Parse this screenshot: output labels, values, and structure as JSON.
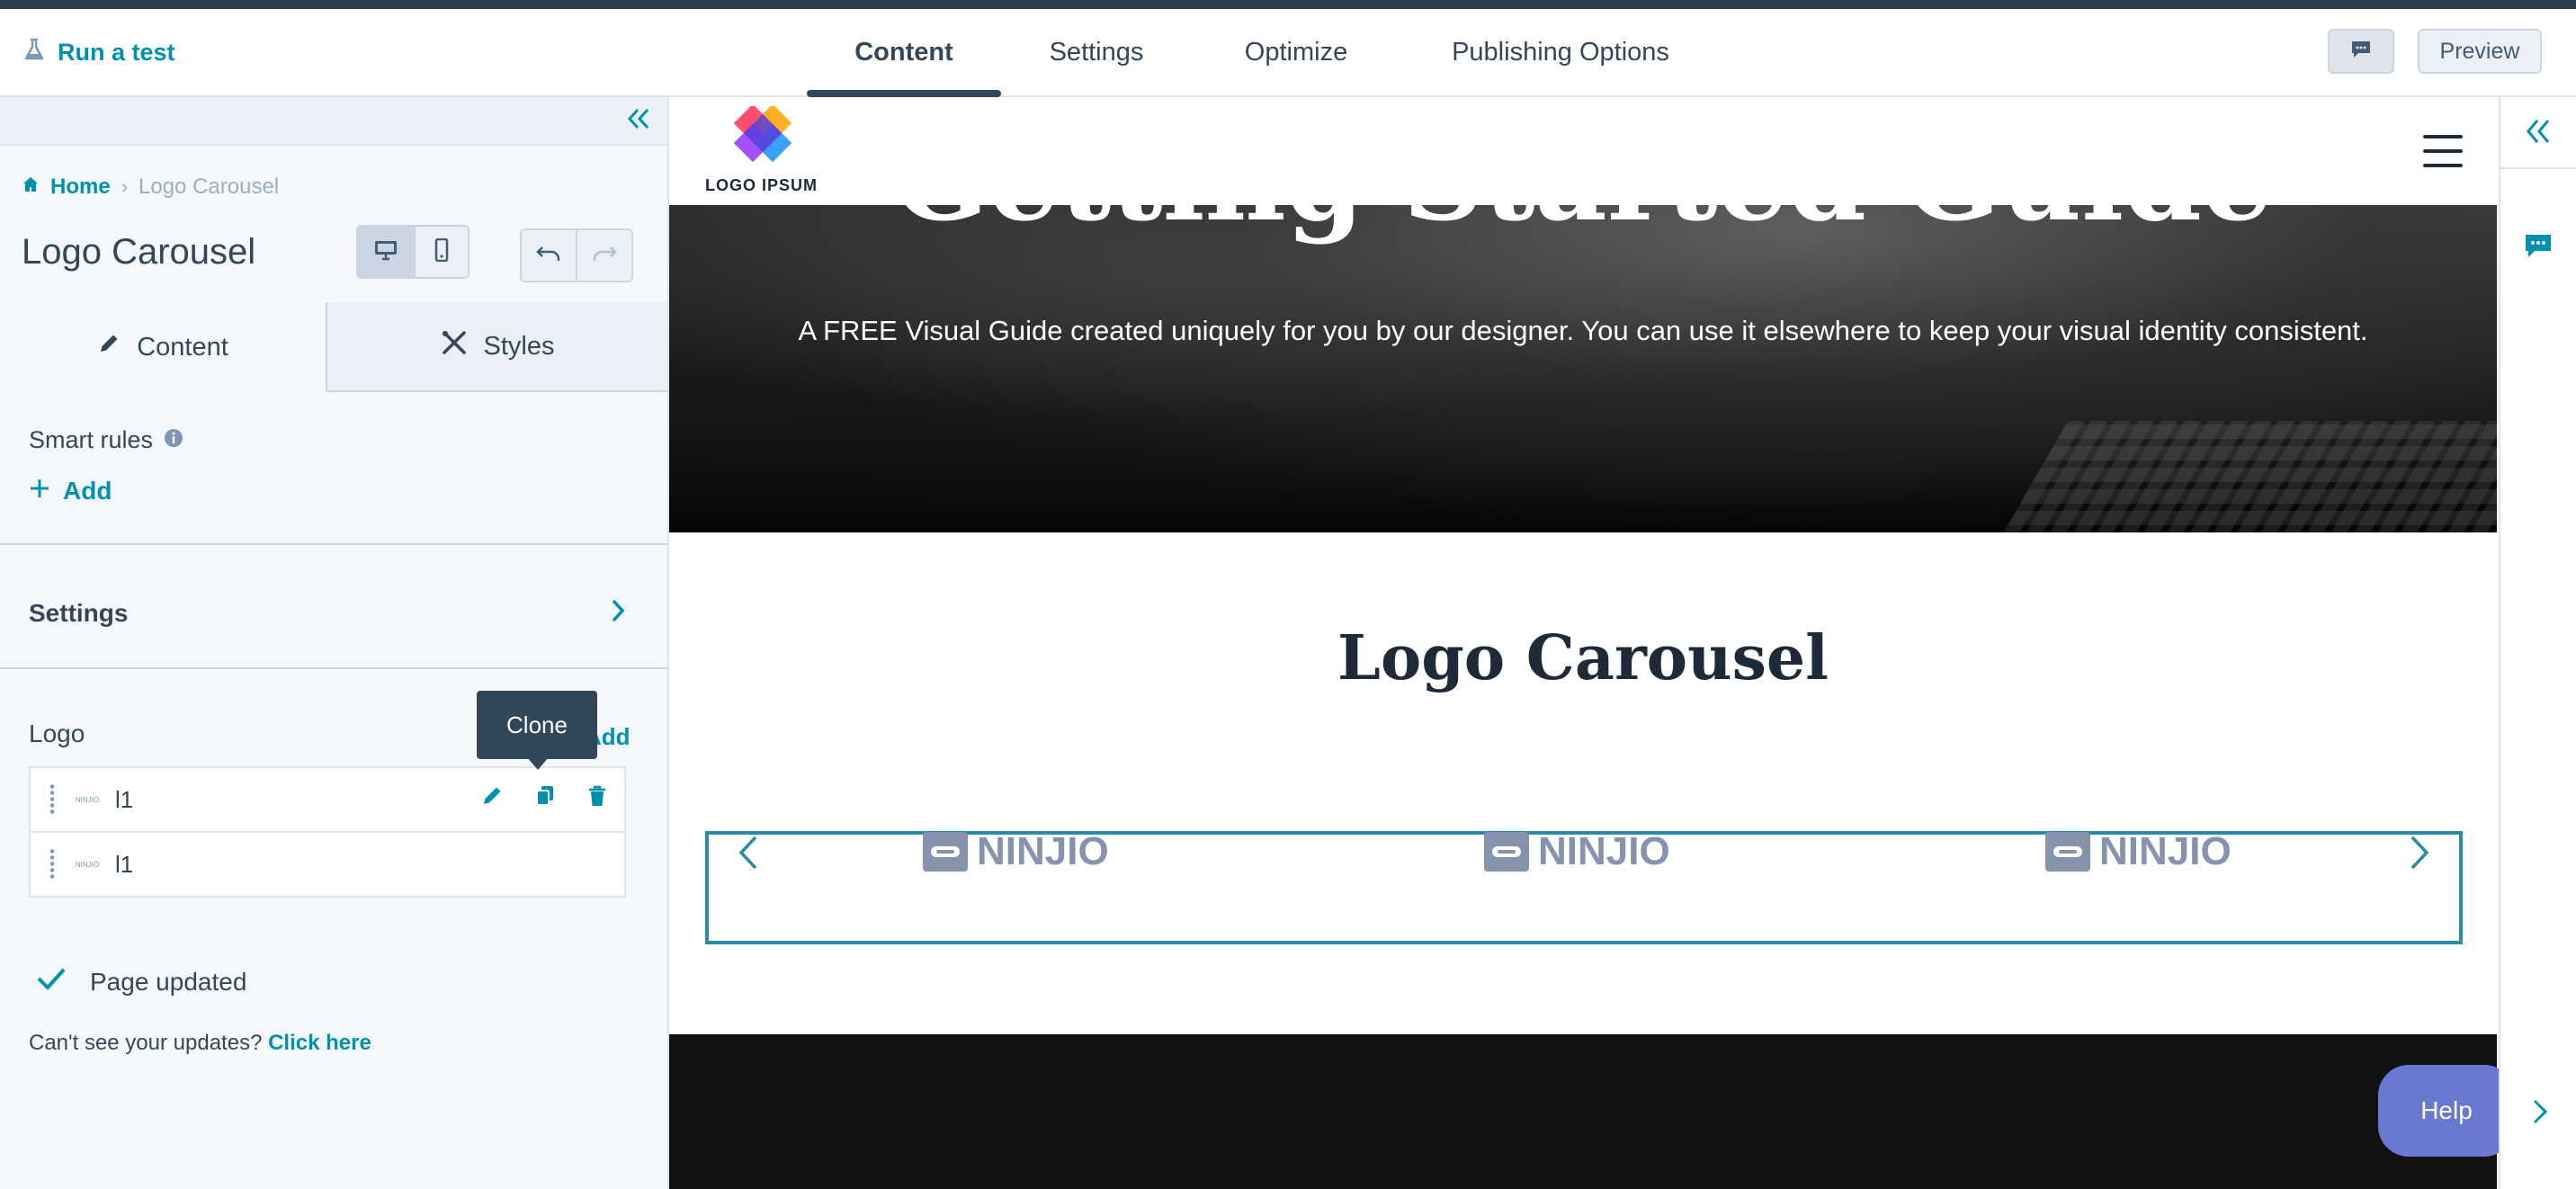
{
  "topbar": {
    "run_test": "Run a test",
    "tabs": [
      {
        "label": "Content"
      },
      {
        "label": "Settings"
      },
      {
        "label": "Optimize"
      },
      {
        "label": "Publishing Options"
      }
    ],
    "active_tab": "Content",
    "preview": "Preview"
  },
  "sidebar": {
    "breadcrumb": {
      "home": "Home",
      "separator": "›",
      "current": "Logo Carousel"
    },
    "title": "Logo Carousel",
    "editor_tabs": {
      "content": "Content",
      "styles": "Styles"
    },
    "smart_rules": {
      "label": "Smart rules",
      "add": "Add"
    },
    "settings": {
      "label": "Settings"
    },
    "logo": {
      "label": "Logo",
      "add": "Add",
      "tooltip": "Clone",
      "items": [
        {
          "label": "l1",
          "thumb": "NINJIO"
        },
        {
          "label": "l1",
          "thumb": "NINJIO"
        }
      ]
    },
    "status": {
      "page_updated": "Page updated",
      "cant_see": "Can't see your updates?",
      "click_here": "Click here"
    }
  },
  "canvas": {
    "site_logo": "LOGO IPSUM",
    "hero": {
      "title": "Getting Started Guide",
      "subtitle": "A FREE Visual Guide created uniquely for you by our designer. You can use it elsewhere to keep your visual identity consistent."
    },
    "carousel": {
      "heading": "Logo Carousel",
      "logos": [
        "NINJIO",
        "NINJIO",
        "NINJIO"
      ]
    },
    "help": "Help"
  },
  "colors": {
    "accent": "#0091ae",
    "text": "#33475b",
    "carousel_border": "#2a8da3",
    "help_button": "#6a78d1",
    "ninjio_logo": "#8593ad"
  },
  "icons": [
    "flask-icon",
    "chat-icon",
    "double-chevron-left-icon",
    "home-icon",
    "desktop-icon",
    "mobile-icon",
    "undo-icon",
    "redo-icon",
    "pencil-icon",
    "styles-icon",
    "info-icon",
    "plus-icon",
    "chevron-right-icon",
    "drag-handle-icon",
    "edit-icon",
    "clone-icon",
    "delete-icon",
    "check-icon",
    "hamburger-menu-icon",
    "chevron-left-icon",
    "comment-icon"
  ]
}
